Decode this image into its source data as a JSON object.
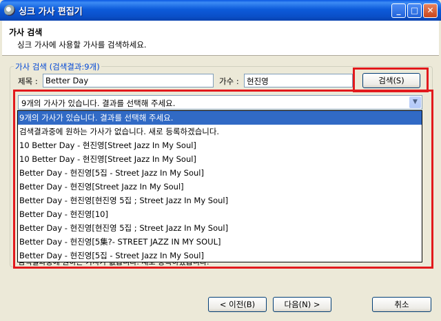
{
  "window": {
    "title": "싱크 가사 편집기",
    "controls": [
      "_",
      "□",
      "✕"
    ]
  },
  "header": {
    "title": "가사 검색",
    "subtitle": "싱크 가사에 사용할 가사를 검색하세요."
  },
  "search_group": {
    "label": "가사 검색 (검색결과:9개)",
    "title_label": "제목 :",
    "title_value": "Better Day",
    "artist_label": "가수 :",
    "artist_value": "현진영",
    "search_button": "검색(S)"
  },
  "results": {
    "selected": "9개의 가사가 있습니다. 결과를 선택해 주세요.",
    "items": [
      "9개의 가사가 있습니다. 결과를 선택해 주세요.",
      "검색결과중에 원하는 가사가 없습니다. 새로 등록하겠습니다.",
      "10 Better Day - 현진영[Street Jazz In My Soul]",
      "10 Better Day - 현진영[Street Jazz In My Soul]",
      "Better Day - 현진영[5집 - Street Jazz In My Soul]",
      "Better Day - 현진영[Street Jazz In My Soul]",
      "Better Day - 현진영[현진영 5집 ; Street Jazz In My Soul]",
      "Better Day - 현진영[10]",
      "Better Day - 현진영[현진영 5집 ; Street Jazz In My Soul]",
      "Better Day - 현진영[5集?- STREET JAZZ IN MY SOUL]",
      "Better Day - 현진영[5집 - Street Jazz In My Soul]"
    ],
    "behind_text": "검색결과중에 원하는 가사가 없습니다. 새로 등록하겠습니다."
  },
  "footer": {
    "prev_button": "< 이전(B)",
    "next_button": "다음(N) >",
    "cancel_button": "취소"
  }
}
